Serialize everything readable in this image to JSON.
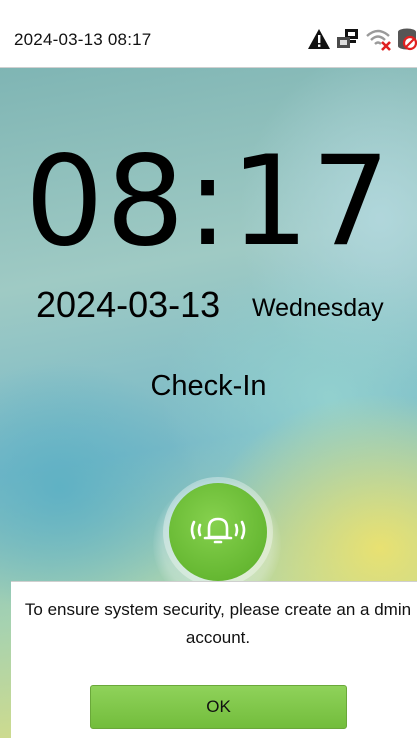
{
  "status_bar": {
    "datetime": "2024-03-13 08:17",
    "icons": [
      "warning-icon",
      "ethernet-icon",
      "wifi-disconnected-icon",
      "cloud-disconnected-icon"
    ]
  },
  "clock": {
    "time": "08:17",
    "date": "2024-03-13",
    "weekday": "Wednesday"
  },
  "attendance": {
    "status": "Check-In",
    "bell_icon": "doorbell-icon"
  },
  "dialog": {
    "message": "To ensure system security, please create an a dmin account.",
    "ok_label": "OK"
  },
  "colors": {
    "accent_green": "#73bd3c",
    "warning_red": "#e02020"
  }
}
